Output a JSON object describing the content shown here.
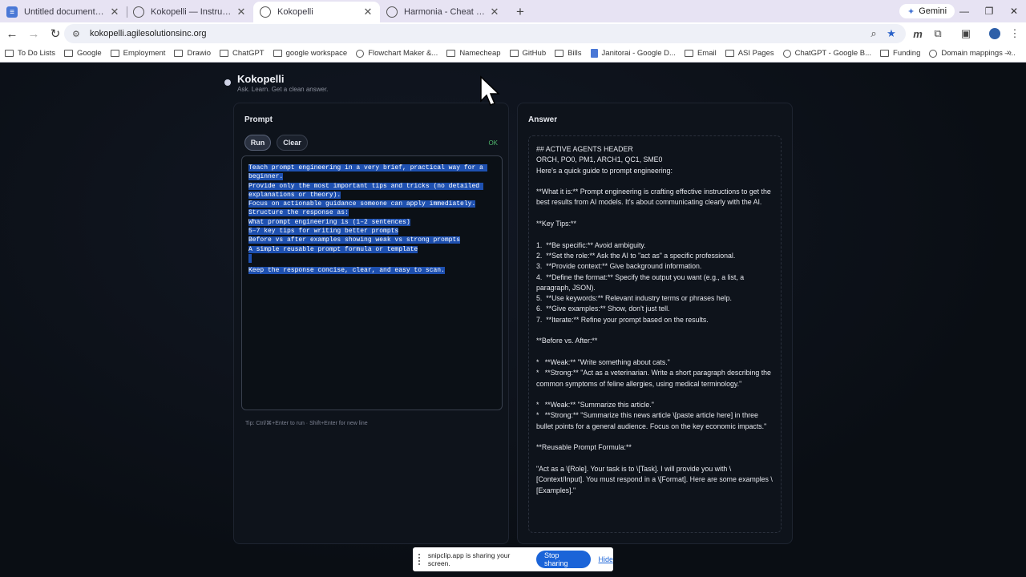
{
  "browser": {
    "tabs": [
      {
        "title": "Untitled document - Google Docs",
        "favicon": "docs-icon",
        "color": "#4a78d6",
        "active": false
      },
      {
        "title": "Kokopelli — Instructional Page",
        "favicon": "globe-icon",
        "color": "#555555",
        "active": false
      },
      {
        "title": "Kokopelli",
        "favicon": "globe-icon",
        "color": "#555555",
        "active": true
      },
      {
        "title": "Harmonia - Cheat Sheet Generator",
        "favicon": "globe-icon",
        "color": "#555555",
        "active": false
      }
    ],
    "gemini_label": "Gemini",
    "url": "kokopelli.agilesolutionsinc.org",
    "bookmarks": [
      {
        "label": "To Do Lists",
        "icon": "folder-icon"
      },
      {
        "label": "Google",
        "icon": "folder-icon"
      },
      {
        "label": "Employment",
        "icon": "folder-icon"
      },
      {
        "label": "Drawio",
        "icon": "folder-icon"
      },
      {
        "label": "ChatGPT",
        "icon": "folder-icon"
      },
      {
        "label": "google workspace",
        "icon": "folder-icon"
      },
      {
        "label": "Flowchart Maker &...",
        "icon": "flowchart-icon"
      },
      {
        "label": "Namecheap",
        "icon": "folder-icon"
      },
      {
        "label": "GitHub",
        "icon": "folder-icon"
      },
      {
        "label": "Bills",
        "icon": "folder-icon"
      },
      {
        "label": "Janitorai - Google D...",
        "icon": "docs-icon"
      },
      {
        "label": "Email",
        "icon": "folder-icon"
      },
      {
        "label": "ASI Pages",
        "icon": "folder-icon"
      },
      {
        "label": "ChatGPT - Google B...",
        "icon": "globe-icon"
      },
      {
        "label": "Funding",
        "icon": "folder-icon"
      },
      {
        "label": "Domain mappings –...",
        "icon": "arrow-icon"
      }
    ]
  },
  "app": {
    "title": "Kokopelli",
    "tagline": "Ask. Learn. Get a clean answer."
  },
  "prompt": {
    "title": "Prompt",
    "run_label": "Run",
    "clear_label": "Clear",
    "status": "OK",
    "lines": [
      "Teach prompt engineering in a very brief, practical way for a ",
      "beginner.",
      "Provide only the most important tips and tricks (no detailed ",
      "explanations or theory).",
      "Focus on actionable guidance someone can apply immediately.",
      "Structure the response as:",
      "What prompt engineering is (1–2 sentences)",
      "5–7 key tips for writing better prompts",
      "Before vs after examples showing weak vs strong prompts",
      "A simple reusable prompt formula or template",
      "",
      "Keep the response concise, clear, and easy to scan."
    ],
    "tip": "Tip: Ctrl/⌘+Enter to run · Shift+Enter for new line"
  },
  "answer": {
    "title": "Answer",
    "paragraphs": [
      "## ACTIVE AGENTS HEADER\nORCH, PO0, PM1, ARCH1, QC1, SME0\nHere's a quick guide to prompt engineering:",
      "**What it is:** Prompt engineering is crafting effective instructions to get the best results from AI models. It's about communicating clearly with the AI.",
      "**Key Tips:**",
      "1.  **Be specific:** Avoid ambiguity.\n2.  **Set the role:** Ask the AI to \"act as\" a specific professional.\n3.  **Provide context:** Give background information.\n4.  **Define the format:** Specify the output you want (e.g., a list, a paragraph, JSON).\n5.  **Use keywords:** Relevant industry terms or phrases help.\n6.  **Give examples:** Show, don't just tell.\n7.  **Iterate:** Refine your prompt based on the results.",
      "**Before vs. After:**",
      "*   **Weak:** \"Write something about cats.\"\n*   **Strong:** \"Act as a veterinarian. Write a short paragraph describing the common symptoms of feline allergies, using medical terminology.\"",
      "*   **Weak:** \"Summarize this article.\"\n*   **Strong:** \"Summarize this news article \\[paste article here] in three bullet points for a general audience. Focus on the key economic impacts.\"",
      "**Reusable Prompt Formula:**",
      "\"Act as a \\[Role]. Your task is to \\[Task]. I will provide you with \\[Context/Input]. You must respond in a \\[Format]. Here are some examples \\[Examples].\""
    ]
  },
  "share_bar": {
    "message": "snipclip.app is sharing your screen.",
    "stop_label": "Stop sharing",
    "hide_label": "Hide"
  }
}
